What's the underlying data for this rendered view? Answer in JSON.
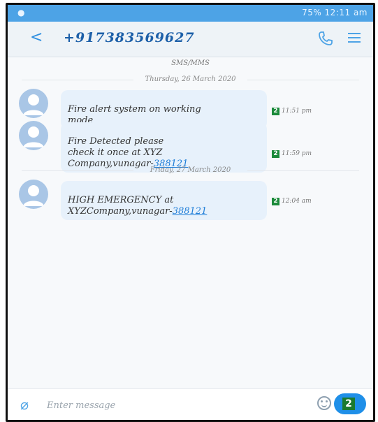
{
  "status_bar": {
    "left_icon": "circle-notification-icon",
    "right_text": "75% 12:11 am"
  },
  "header": {
    "title": "+917383569627",
    "call_icon": "phone-icon",
    "menu_icon": "menu-icon"
  },
  "channel_label": "SMS/MMS",
  "messages": [
    {
      "day": "Thursday, 26 March 2020",
      "text": "Fire alert system on working\nmode",
      "link": "",
      "time": "11:51 pm",
      "sim": "2"
    },
    {
      "day": "",
      "text": "Fire Detected please\ncheck it once at XYZ\nCompany,vunagar-",
      "link": "388121",
      "time": "11:59 pm",
      "sim": "2"
    },
    {
      "day": "Friday, 27 March 2020",
      "text": "HIGH EMERGENCY at\nXYZCompany,vunagar-",
      "link": "388121",
      "time": "12:04 am",
      "sim": "2"
    }
  ],
  "composer": {
    "placeholder": "Enter message",
    "send_sim": "2"
  },
  "colors": {
    "accent": "#4da3e6",
    "send_button": "#1f8fe8",
    "sim_badge": "#1b8a3a"
  }
}
